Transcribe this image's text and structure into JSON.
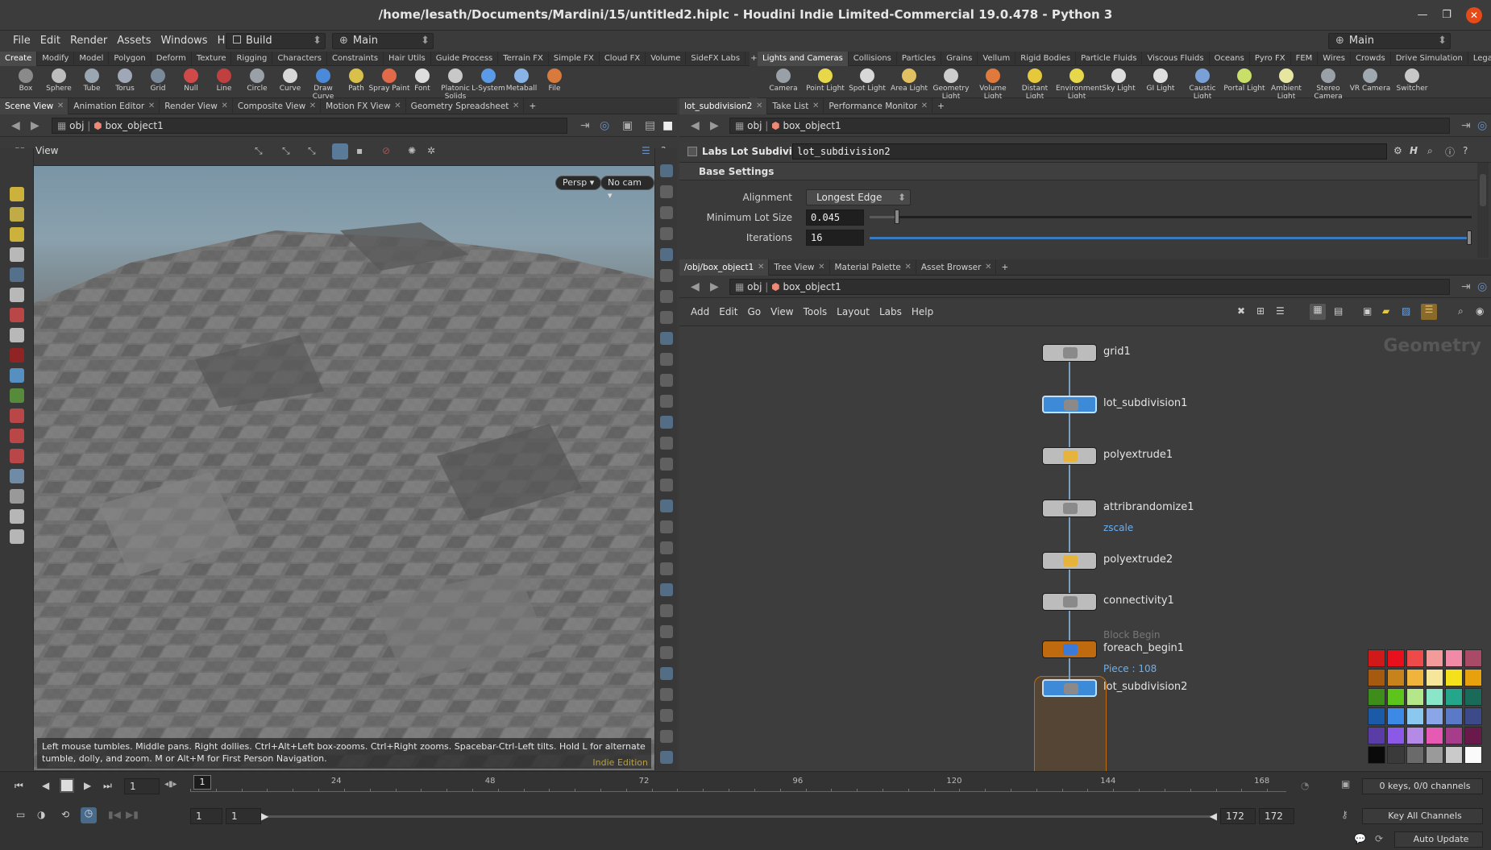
{
  "window": {
    "title": "/home/lesath/Documents/Mardini/15/untitled2.hiplc - Houdini Indie Limited-Commercial 19.0.478 - Python 3"
  },
  "menu": [
    "File",
    "Edit",
    "Render",
    "Assets",
    "Windows",
    "Help"
  ],
  "desktop": {
    "build": "Build",
    "main_left": "Main",
    "main_right": "Main"
  },
  "shelf_tabs_left": [
    "Create",
    "Modify",
    "Model",
    "Polygon",
    "Deform",
    "Texture",
    "Rigging",
    "Characters",
    "Constraints",
    "Hair Utils",
    "Guide Process",
    "Terrain FX",
    "Simple FX",
    "Cloud FX",
    "Volume",
    "SideFX Labs"
  ],
  "shelf_tabs_right": [
    "Lights and Cameras",
    "Collisions",
    "Particles",
    "Grains",
    "Vellum",
    "Rigid Bodies",
    "Particle Fluids",
    "Viscous Fluids",
    "Oceans",
    "Pyro FX",
    "FEM",
    "Wires",
    "Crowds",
    "Drive Simulation",
    "Legacy Pyro FX"
  ],
  "tools_left": [
    "Box",
    "Sphere",
    "Tube",
    "Torus",
    "Grid",
    "Null",
    "Line",
    "Circle",
    "Curve",
    "Draw Curve",
    "Path",
    "Spray Paint",
    "Font",
    "Platonic Solids",
    "L-System",
    "Metaball",
    "File"
  ],
  "tools_right": [
    "Camera",
    "Point Light",
    "Spot Light",
    "Area Light",
    "Geometry Light",
    "Volume Light",
    "Distant Light",
    "Environment Light",
    "Sky Light",
    "GI Light",
    "Caustic Light",
    "Portal Light",
    "Ambient Light",
    "Stereo Camera",
    "VR Camera",
    "Switcher"
  ],
  "left_pane": {
    "tabs": [
      "Scene View",
      "Animation Editor",
      "Render View",
      "Composite View",
      "Motion FX View",
      "Geometry Spreadsheet"
    ],
    "path_obj": "obj",
    "path_node": "box_object1",
    "view_label": "View",
    "persp": "Persp ▾",
    "nocam": "No cam ▾",
    "hint": "Left mouse tumbles. Middle pans. Right dollies. Ctrl+Alt+Left box-zooms. Ctrl+Right zooms. Spacebar-Ctrl-Left tilts. Hold L for alternate tumble, dolly, and zoom.    M or Alt+M for First Person Navigation.",
    "edition": "Indie Edition"
  },
  "params_pane": {
    "tabs": [
      "lot_subdivision2",
      "Take List",
      "Performance Monitor"
    ],
    "path_obj": "obj",
    "path_node": "box_object1",
    "node_type": "Labs Lot Subdivision",
    "node_name": "lot_subdivision2",
    "section": "Base Settings",
    "alignment_label": "Alignment",
    "alignment_value": "Longest Edge",
    "min_lot_label": "Minimum Lot Size",
    "min_lot_value": "0.045",
    "min_lot_fraction": 0.045,
    "iterations_label": "Iterations",
    "iterations_value": "16",
    "iterations_fraction": 1.0
  },
  "network_pane": {
    "tabs": [
      "/obj/box_object1",
      "Tree View",
      "Material Palette",
      "Asset Browser"
    ],
    "path_obj": "obj",
    "path_node": "box_object1",
    "menu": [
      "Add",
      "Edit",
      "Go",
      "View",
      "Tools",
      "Layout",
      "Labs",
      "Help"
    ],
    "context_label": "Geometry",
    "nodes": [
      {
        "name": "grid1"
      },
      {
        "name": "lot_subdivision1"
      },
      {
        "name": "polyextrude1"
      },
      {
        "name": "attribrandomize1",
        "sub": "zscale"
      },
      {
        "name": "polyextrude2"
      },
      {
        "name": "connectivity1"
      },
      {
        "name": "foreach_begin1",
        "pre": "Block Begin",
        "sub": "Piece : 108"
      },
      {
        "name": "lot_subdivision2"
      }
    ]
  },
  "palette_colors": [
    "#d01a1a",
    "#e8101c",
    "#ee4a4a",
    "#f39a9a",
    "#f18aa6",
    "#a94a66",
    "#a55a10",
    "#c8821c",
    "#f0b43c",
    "#f5e69a",
    "#f5e01c",
    "#e6a10c",
    "#3e8c1a",
    "#5cc41a",
    "#b4e68a",
    "#8ae6c8",
    "#24a68a",
    "#1a6a5a",
    "#1a5aa6",
    "#3c8ae6",
    "#8ac8f0",
    "#8aa6e6",
    "#5a7ac8",
    "#3c4a8a",
    "#5a3ca6",
    "#8a5ae6",
    "#b48ae6",
    "#e65ab4",
    "#a63c8a",
    "#6a1a4a",
    "#0a0a0a",
    "#3a3a3a",
    "#6a6a6a",
    "#9a9a9a",
    "#cacaca",
    "#fafafa"
  ],
  "timeline": {
    "current_frame": "1",
    "marker": "1",
    "ticks": [
      "24",
      "48",
      "72",
      "96",
      "120",
      "144",
      "168"
    ],
    "range_start": "1",
    "range_start2": "1",
    "range_end": "172",
    "range_end2": "172",
    "keys_info": "0 keys, 0/0 channels",
    "key_all": "Key All Channels",
    "auto_update": "Auto Update"
  }
}
